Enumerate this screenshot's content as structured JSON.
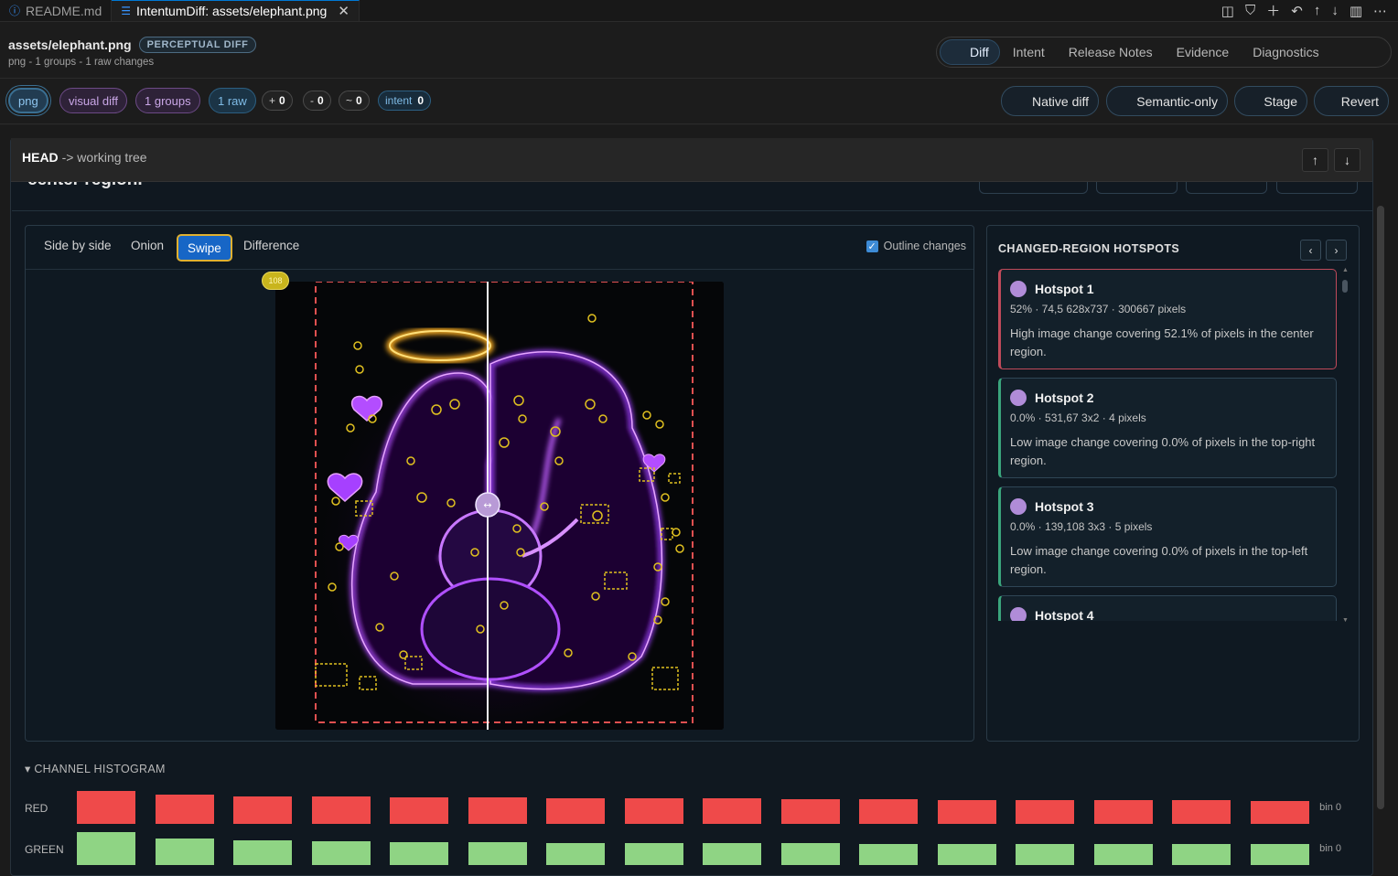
{
  "tabs": [
    {
      "label": "README.md",
      "icon": "info-icon",
      "active": false
    },
    {
      "label": "IntentumDiff: assets/elephant.png",
      "icon": "diff-file-icon",
      "active": true
    }
  ],
  "header": {
    "file_name": "assets/elephant.png",
    "badge": "PERCEPTUAL DIFF",
    "subtitle": "png - 1 groups - 1 raw changes",
    "view_tabs": [
      "Diff",
      "Intent",
      "Release Notes",
      "Evidence",
      "Diagnostics"
    ],
    "active_view": "Diff"
  },
  "chips": {
    "png": "png",
    "visual_diff": "visual diff",
    "groups": "1 groups",
    "raw": "1 raw",
    "added_prefix": "+",
    "added": "0",
    "removed_prefix": "-",
    "removed": "0",
    "modified_prefix": "~",
    "modified": "0",
    "intent_label": "intent",
    "intent": "0"
  },
  "actions": [
    "Native diff",
    "Semantic-only",
    "Stage",
    "Revert"
  ],
  "compare": {
    "from": "HEAD",
    "arrow": "->",
    "to": "working tree",
    "partial_text": "center region."
  },
  "viewer": {
    "modes": [
      "Side by side",
      "Onion",
      "Swipe",
      "Difference"
    ],
    "active_mode": "Swipe",
    "outline_label": "Outline changes",
    "outline_checked": true,
    "change_count": "108"
  },
  "hotspots": {
    "title": "CHANGED-REGION HOTSPOTS",
    "items": [
      {
        "name": "Hotspot 1",
        "meta": "52% · 74,5 628x737 · 300667 pixels",
        "desc": "High image change covering 52.1% of pixels in the center region.",
        "selected": true
      },
      {
        "name": "Hotspot 2",
        "meta": "0.0% · 531,67 3x2 · 4 pixels",
        "desc": "Low image change covering 0.0% of pixels in the top-right region.",
        "selected": false
      },
      {
        "name": "Hotspot 3",
        "meta": "0.0% · 139,108 3x3 · 5 pixels",
        "desc": "Low image change covering 0.0% of pixels in the top-left region.",
        "selected": false
      },
      {
        "name": "Hotspot 4",
        "meta": "",
        "desc": "",
        "selected": false
      }
    ]
  },
  "histogram": {
    "title": "CHANNEL HISTOGRAM",
    "toggle": "▾",
    "rows": [
      {
        "label": "RED",
        "bin": "bin 0",
        "color": "#ef4a4a",
        "levels": [
          1.0,
          0.88,
          0.83,
          0.83,
          0.8,
          0.8,
          0.77,
          0.77,
          0.77,
          0.74,
          0.74,
          0.71,
          0.71,
          0.71,
          0.71,
          0.69
        ]
      },
      {
        "label": "GREEN",
        "bin": "bin 0",
        "color": "#8fd484",
        "levels": [
          1.0,
          0.8,
          0.74,
          0.71,
          0.69,
          0.69,
          0.66,
          0.66,
          0.66,
          0.66,
          0.63,
          0.63,
          0.63,
          0.63,
          0.63,
          0.63
        ]
      }
    ]
  }
}
